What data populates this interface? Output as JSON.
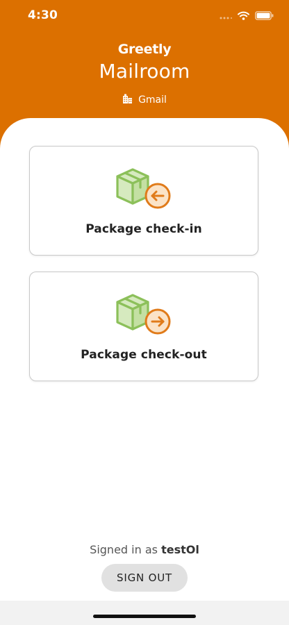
{
  "status_bar": {
    "time": "4:30",
    "icons": [
      "signal-icon",
      "wifi-icon",
      "battery-icon"
    ]
  },
  "header": {
    "brand": "Greetly",
    "title": "Mailroom",
    "tenant": {
      "icon": "building-icon",
      "label": "Gmail"
    }
  },
  "actions": [
    {
      "label": "Package check-in",
      "icon": "package-check-in-icon"
    },
    {
      "label": "Package check-out",
      "icon": "package-check-out-icon"
    }
  ],
  "footer": {
    "signed_in_prefix": "Signed in as",
    "username": "testOl",
    "sign_out_label": "SIGN OUT"
  },
  "colors": {
    "header_orange": "#dc7000",
    "box_green": "#8cc05a",
    "arrow_orange": "#e07b1a",
    "button_gray": "#e1e1e1"
  }
}
